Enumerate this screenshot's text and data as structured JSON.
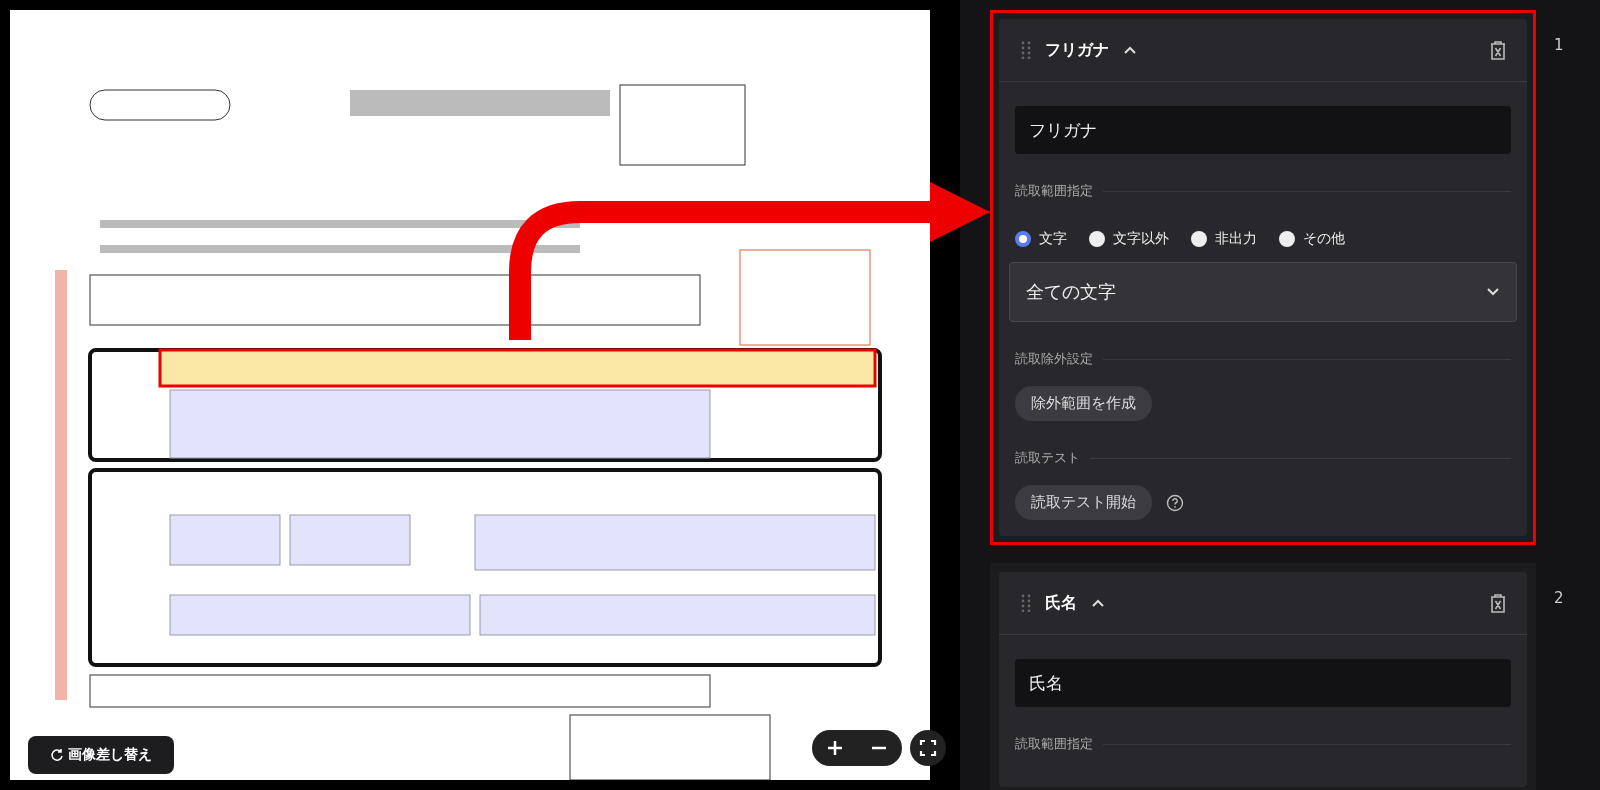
{
  "image_panel": {
    "replace_button": "画像差し替え"
  },
  "fields": [
    {
      "number": "1",
      "title": "フリガナ",
      "expanded": true,
      "highlighted": true,
      "name_value": "フリガナ",
      "range_label": "読取範囲指定",
      "options": [
        {
          "label": "文字",
          "selected": true
        },
        {
          "label": "文字以外",
          "selected": false
        },
        {
          "label": "非出力",
          "selected": false
        },
        {
          "label": "その他",
          "selected": false
        }
      ],
      "select_value": "全ての文字",
      "exclude_label": "読取除外設定",
      "exclude_button": "除外範囲を作成",
      "test_label": "読取テスト",
      "test_button": "読取テスト開始"
    },
    {
      "number": "2",
      "title": "氏名",
      "expanded": true,
      "highlighted": false,
      "name_value": "氏名",
      "range_label": "読取範囲指定"
    }
  ]
}
